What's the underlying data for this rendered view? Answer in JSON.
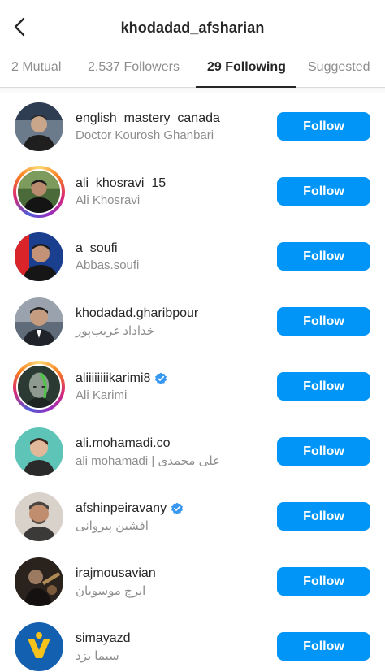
{
  "header": {
    "title": "khodadad_afsharian",
    "back_icon": "chevron-left-icon"
  },
  "tabs": [
    {
      "label": "2 Mutual",
      "active": false
    },
    {
      "label": "2,537 Followers",
      "active": false
    },
    {
      "label": "29 Following",
      "active": true
    },
    {
      "label": "Suggested",
      "active": false
    }
  ],
  "colors": {
    "follow_button": "#0095f6",
    "verified_badge": "#3897f0",
    "secondary_text": "#8e8e8e",
    "primary_text": "#262626"
  },
  "accounts": [
    {
      "username": "english_mastery_canada",
      "name": "Doctor Kourosh Ghanbari",
      "verified": false,
      "story_ring": false,
      "button": "Follow"
    },
    {
      "username": "ali_khosravi_15",
      "name": "Ali Khosravi",
      "verified": false,
      "story_ring": true,
      "button": "Follow"
    },
    {
      "username": "a_soufi",
      "name": "Abbas.soufi",
      "verified": false,
      "story_ring": false,
      "button": "Follow"
    },
    {
      "username": "khodadad.gharibpour",
      "name": "خداداد غریب‌پور",
      "verified": false,
      "story_ring": false,
      "button": "Follow"
    },
    {
      "username": "aliiiiiiiikarimi8",
      "name": "Ali Karimi",
      "verified": true,
      "story_ring": true,
      "button": "Follow"
    },
    {
      "username": "ali.mohamadi.co",
      "name": "ali mohamadi | علی محمدی",
      "verified": false,
      "story_ring": false,
      "button": "Follow"
    },
    {
      "username": "afshinpeiravany",
      "name": "افشین پیروانی",
      "verified": true,
      "story_ring": false,
      "button": "Follow"
    },
    {
      "username": "irajmousavian",
      "name": "ایرج موسویان",
      "verified": false,
      "story_ring": false,
      "button": "Follow"
    },
    {
      "username": "simayazd",
      "name": "سیما یزد",
      "verified": false,
      "story_ring": false,
      "button": "Follow"
    }
  ]
}
